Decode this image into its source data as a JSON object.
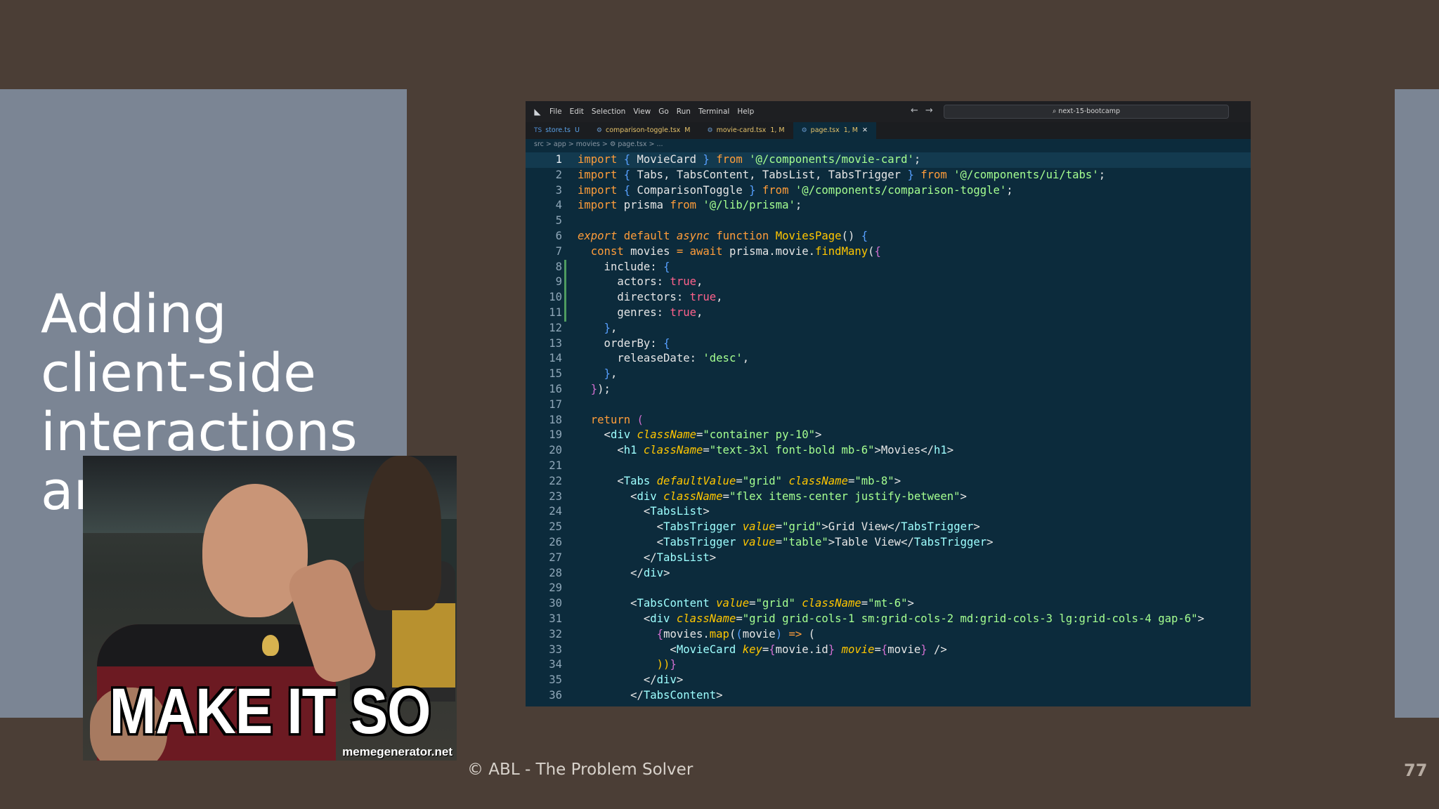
{
  "slide": {
    "title_lines": [
      "Adding",
      "client-side",
      "interactions",
      "ar"
    ],
    "footer": "© ABL - The Problem Solver",
    "page_number": "77"
  },
  "meme": {
    "caption": "MAKE IT SO",
    "watermark": "memegenerator.net"
  },
  "vscode": {
    "menu": [
      "File",
      "Edit",
      "Selection",
      "View",
      "Go",
      "Run",
      "Terminal",
      "Help"
    ],
    "search": "next-15-bootcamp",
    "tabs": [
      {
        "icon": "TS",
        "label": "store.ts",
        "status": "U"
      },
      {
        "icon": "⚙",
        "label": "comparison-toggle.tsx",
        "status": "M"
      },
      {
        "icon": "⚙",
        "label": "movie-card.tsx",
        "status": "1, M"
      },
      {
        "icon": "⚙",
        "label": "page.tsx",
        "status": "1, M"
      }
    ],
    "breadcrumb": "src > app > movies > ⚙ page.tsx > ...",
    "line_numbers": [
      "1",
      "2",
      "3",
      "4",
      "5",
      "6",
      "7",
      "8",
      "9",
      "10",
      "11",
      "12",
      "13",
      "14",
      "15",
      "16",
      "17",
      "18",
      "19",
      "20",
      "21",
      "22",
      "23",
      "24",
      "25",
      "26",
      "27",
      "28",
      "29",
      "30",
      "31",
      "32",
      "33",
      "34",
      "35",
      "36"
    ],
    "code_lines": [
      "import { MovieCard } from '@/components/movie-card';",
      "import { Tabs, TabsContent, TabsList, TabsTrigger } from '@/components/ui/tabs';",
      "import { ComparisonToggle } from '@/components/comparison-toggle';",
      "import prisma from '@/lib/prisma';",
      "",
      "export default async function MoviesPage() {",
      "  const movies = await prisma.movie.findMany({",
      "    include: {",
      "      actors: true,",
      "      directors: true,",
      "      genres: true,",
      "    },",
      "    orderBy: {",
      "      releaseDate: 'desc',",
      "    },",
      "  });",
      "",
      "  return (",
      "    <div className=\"container py-10\">",
      "      <h1 className=\"text-3xl font-bold mb-6\">Movies</h1>",
      "",
      "      <Tabs defaultValue=\"grid\" className=\"mb-8\">",
      "        <div className=\"flex items-center justify-between\">",
      "          <TabsList>",
      "            <TabsTrigger value=\"grid\">Grid View</TabsTrigger>",
      "            <TabsTrigger value=\"table\">Table View</TabsTrigger>",
      "          </TabsList>",
      "        </div>",
      "",
      "        <TabsContent value=\"grid\" className=\"mt-6\">",
      "          <div className=\"grid grid-cols-1 sm:grid-cols-2 md:grid-cols-3 lg:grid-cols-4 gap-6\">",
      "            {movies.map((movie) => (",
      "              <MovieCard key={movie.id} movie={movie} />",
      "            ))}",
      "          </div>",
      "        </TabsContent>"
    ]
  }
}
